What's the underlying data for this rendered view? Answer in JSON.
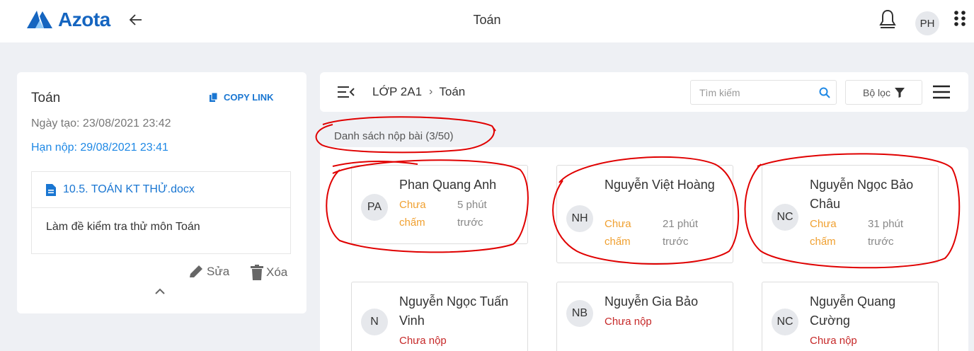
{
  "header": {
    "logo_text": "Azota",
    "title": "Toán",
    "user_initials": "PH"
  },
  "assignment": {
    "title": "Toán",
    "copy_link_label": "COPY LINK",
    "created": "Ngày tạo: 23/08/2021 23:42",
    "deadline": "Hạn nộp: 29/08/2021 23:41",
    "file_name": "10.5. TOÁN KT THỬ.docx",
    "description": "Làm đề kiểm tra thử môn Toán",
    "edit_label": "Sửa",
    "delete_label": "Xóa"
  },
  "breadcrumb": {
    "class_name": "LỚP 2A1",
    "subject": "Toán"
  },
  "search": {
    "placeholder": "Tìm kiếm"
  },
  "filter": {
    "label": "Bộ lọc"
  },
  "list": {
    "title": "Danh sách nộp bài (3/50)",
    "students": [
      {
        "initials": "PA",
        "name": "Phan Quang Anh",
        "status": "Chưa chấm",
        "time": "5 phút trước"
      },
      {
        "initials": "NH",
        "name": "Nguyễn Việt Hoàng",
        "status": "Chưa chấm",
        "time": "21 phút trước"
      },
      {
        "initials": "NC",
        "name": "Nguyễn Ngọc Bảo Châu",
        "status": "Chưa chấm",
        "time": "31 phút trước"
      },
      {
        "initials": "N",
        "name": "Nguyễn Ngọc Tuấn Vinh",
        "status": "Chưa nộp"
      },
      {
        "initials": "NB",
        "name": "Nguyễn Gia Bảo",
        "status": "Chưa nộp"
      },
      {
        "initials": "NC",
        "name": "Nguyễn Quang Cường",
        "status": "Chưa nộp"
      }
    ]
  },
  "colors": {
    "brand": "#1565c0",
    "accent_blue": "#1e88e5",
    "ungraded": "#f0a030",
    "missing": "#c62828",
    "annotation": "#e00000"
  }
}
